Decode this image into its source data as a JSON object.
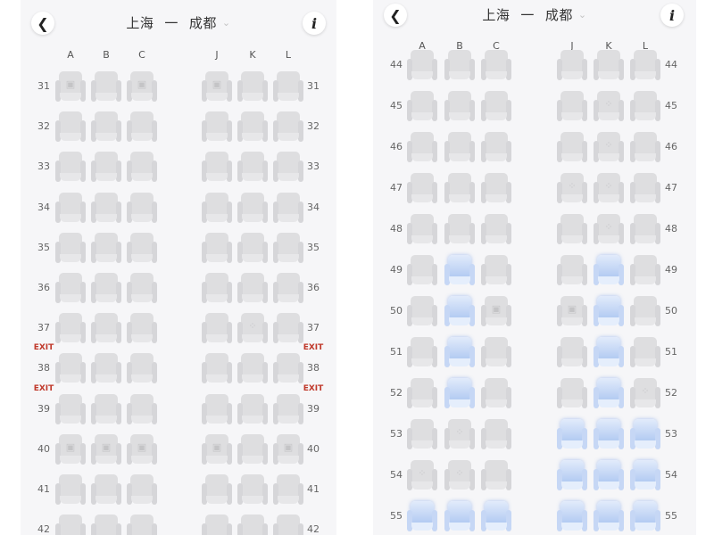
{
  "header": {
    "origin": "上海",
    "separator": "一",
    "destination": "成都",
    "back_icon": "chevron-left-icon",
    "info_icon": "info-icon",
    "dropdown_icon": "chevron-down-icon"
  },
  "colors": {
    "exit": "#c0392b",
    "seat_available": "#adc7f1",
    "seat_taken": "#dedee0"
  },
  "left_panel": {
    "columns_left": [
      "A",
      "B",
      "C"
    ],
    "columns_right": [
      "J",
      "K",
      "L"
    ],
    "rows": [
      {
        "num": "31",
        "seats": [
          "locked",
          "",
          "locked",
          "locked",
          "",
          ""
        ]
      },
      {
        "num": "32",
        "seats": [
          "",
          "",
          "",
          "",
          "",
          ""
        ]
      },
      {
        "num": "33",
        "seats": [
          "",
          "",
          "",
          "",
          "",
          ""
        ]
      },
      {
        "num": "34",
        "seats": [
          "",
          "",
          "",
          "",
          "",
          ""
        ]
      },
      {
        "num": "35",
        "seats": [
          "",
          "",
          "",
          "",
          "",
          ""
        ]
      },
      {
        "num": "36",
        "seats": [
          "",
          "",
          "",
          "",
          "",
          ""
        ]
      },
      {
        "num": "37",
        "seats": [
          "",
          "",
          "",
          "",
          "paw",
          ""
        ]
      },
      {
        "num": "38",
        "seats": [
          "",
          "",
          "",
          "",
          "",
          ""
        ],
        "exit": "EXIT"
      },
      {
        "num": "39",
        "seats": [
          "",
          "",
          "",
          "",
          "",
          ""
        ],
        "exit": "EXIT"
      },
      {
        "num": "40",
        "seats": [
          "locked",
          "locked",
          "locked",
          "locked",
          "",
          "locked"
        ]
      },
      {
        "num": "41",
        "seats": [
          "",
          "",
          "",
          "",
          "",
          ""
        ]
      },
      {
        "num": "42",
        "seats": [
          "",
          "",
          "",
          "",
          "",
          ""
        ]
      }
    ]
  },
  "right_panel": {
    "columns_left": [
      "A",
      "B",
      "C"
    ],
    "columns_right": [
      "J",
      "K",
      "L"
    ],
    "rows": [
      {
        "num": "44",
        "seats": [
          "",
          "",
          "",
          "",
          "",
          ""
        ]
      },
      {
        "num": "45",
        "seats": [
          "",
          "",
          "",
          "",
          "paw",
          ""
        ]
      },
      {
        "num": "46",
        "seats": [
          "",
          "",
          "",
          "",
          "paw",
          ""
        ]
      },
      {
        "num": "47",
        "seats": [
          "",
          "",
          "",
          "paw",
          "paw",
          ""
        ]
      },
      {
        "num": "48",
        "seats": [
          "",
          "",
          "",
          "",
          "paw",
          ""
        ]
      },
      {
        "num": "49",
        "seats": [
          "",
          "avail",
          "",
          "",
          "avail",
          ""
        ]
      },
      {
        "num": "50",
        "seats": [
          "",
          "avail",
          "locked",
          "locked",
          "avail",
          ""
        ]
      },
      {
        "num": "51",
        "seats": [
          "",
          "avail",
          "",
          "",
          "avail",
          ""
        ]
      },
      {
        "num": "52",
        "seats": [
          "",
          "avail",
          "",
          "",
          "avail",
          "paw"
        ]
      },
      {
        "num": "53",
        "seats": [
          "",
          "paw",
          "",
          "avail",
          "avail",
          "avail"
        ]
      },
      {
        "num": "54",
        "seats": [
          "paw",
          "paw",
          "",
          "avail",
          "avail",
          "avail"
        ]
      },
      {
        "num": "55",
        "seats": [
          "avail",
          "avail",
          "avail",
          "avail",
          "avail",
          "avail"
        ]
      }
    ]
  }
}
